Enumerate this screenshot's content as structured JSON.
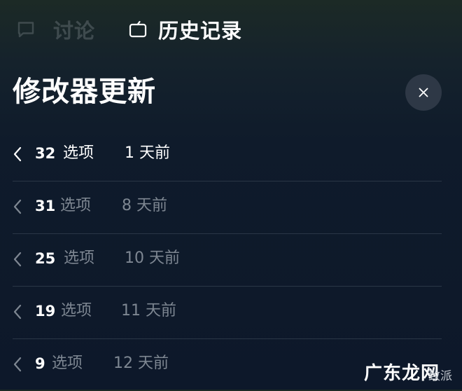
{
  "tabs": {
    "discuss": {
      "label": "讨论",
      "icon": "chat-bubble-icon"
    },
    "history": {
      "label": "历史记录",
      "icon": "history-icon"
    }
  },
  "header": {
    "title": "修改器更新",
    "close_icon": "close-icon"
  },
  "versions": [
    {
      "count": "32",
      "unit": "选项",
      "age": "1 天前",
      "active": true
    },
    {
      "count": "31",
      "unit": "选项",
      "age": "8 天前",
      "active": false
    },
    {
      "count": "25",
      "unit": "选项",
      "age": "10 天前",
      "active": false
    },
    {
      "count": "19",
      "unit": "选项",
      "age": "11 天前",
      "active": false
    },
    {
      "count": "9",
      "unit": "选项",
      "age": "12 天前",
      "active": false
    }
  ],
  "watermark": {
    "main": "广东龙网",
    "sub": "致派"
  },
  "colors": {
    "background_top": "#1c2a26",
    "background_bottom": "#0d182a",
    "divider": "#2a3646",
    "muted_text": "#7e8792",
    "close_button_bg": "#2e3846"
  }
}
